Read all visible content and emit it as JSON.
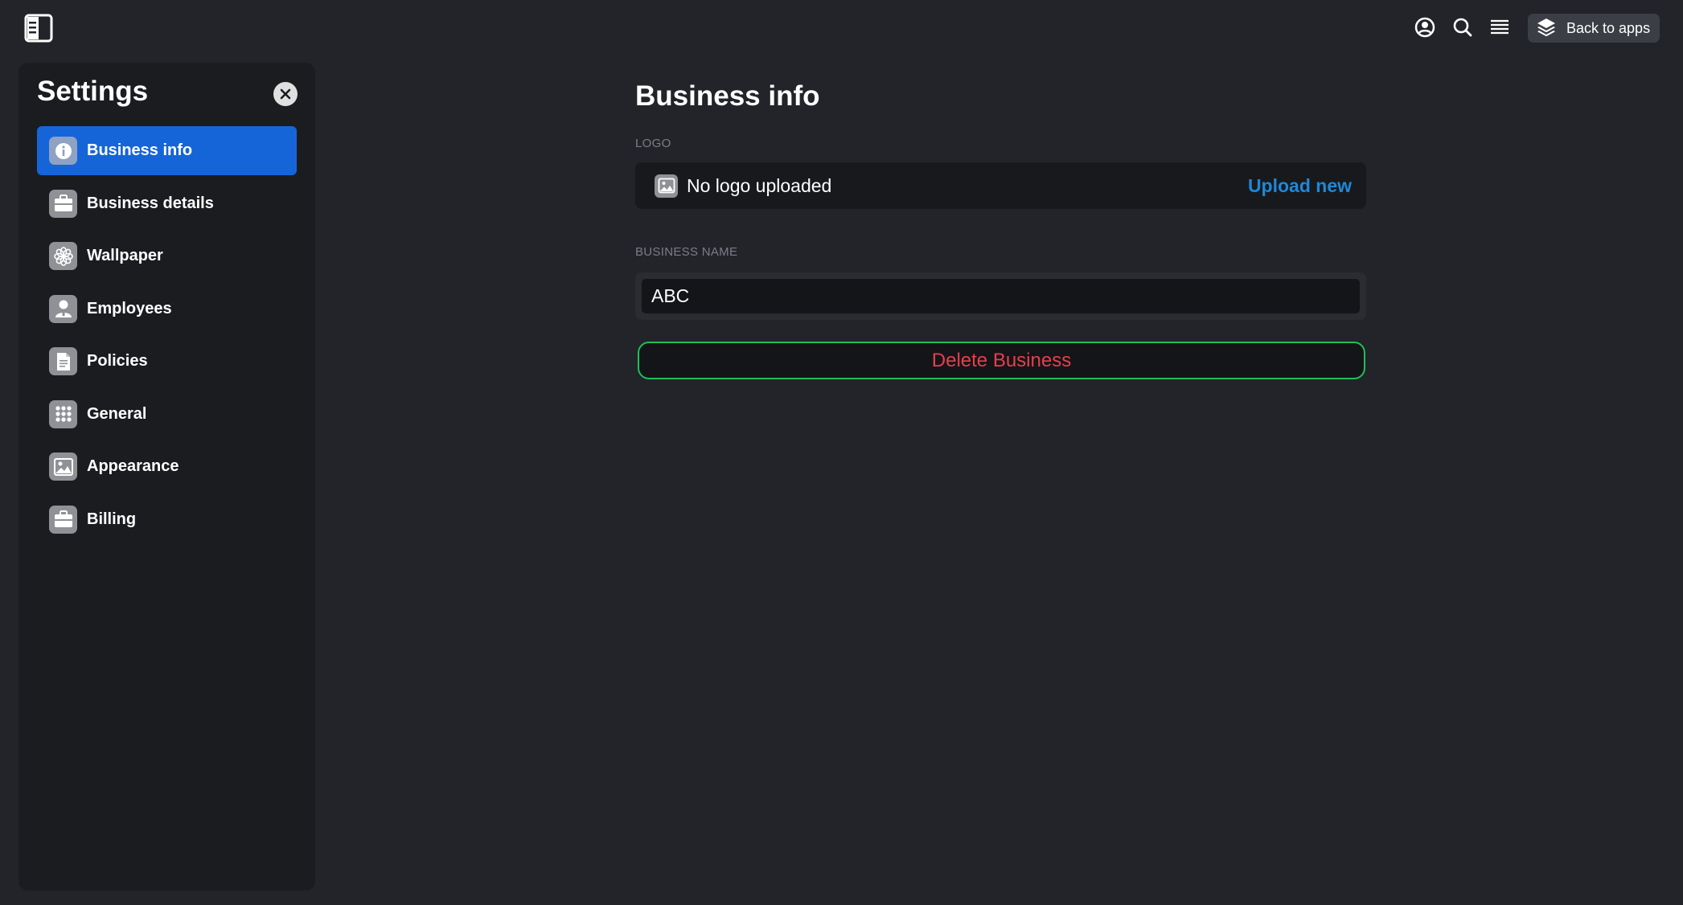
{
  "topbar": {
    "back_label": "Back to apps"
  },
  "sidebar": {
    "title": "Settings",
    "items": [
      {
        "label": "Business info",
        "icon": "info-icon",
        "active": true
      },
      {
        "label": "Business details",
        "icon": "briefcase-icon",
        "active": false
      },
      {
        "label": "Wallpaper",
        "icon": "flower-icon",
        "active": false
      },
      {
        "label": "Employees",
        "icon": "person-icon",
        "active": false
      },
      {
        "label": "Policies",
        "icon": "document-icon",
        "active": false
      },
      {
        "label": "General",
        "icon": "grid-icon",
        "active": false
      },
      {
        "label": "Appearance",
        "icon": "image-icon",
        "active": false
      },
      {
        "label": "Billing",
        "icon": "briefcase-icon",
        "active": false
      }
    ]
  },
  "main": {
    "title": "Business info",
    "logo": {
      "label": "LOGO",
      "status": "No logo uploaded",
      "upload_label": "Upload new"
    },
    "business_name": {
      "label": "BUSINESS NAME",
      "value": "ABC"
    },
    "delete_label": "Delete Business"
  },
  "colors": {
    "background": "#22242a",
    "sidebar": "#1b1c20",
    "accent": "#1565d8",
    "link": "#1e88d8",
    "danger_text": "#e83e4c",
    "danger_border": "#1fbf55"
  }
}
